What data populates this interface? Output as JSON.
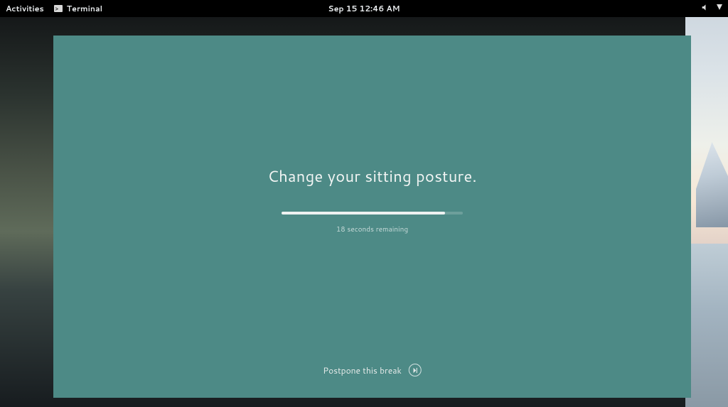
{
  "topbar": {
    "activities": "Activities",
    "app_name": "Terminal",
    "clock": "Sep 15  12:46 AM"
  },
  "break": {
    "message": "Change your sitting posture.",
    "remaining_text": "18 seconds remaining",
    "postpone_label": "Postpone this break"
  }
}
